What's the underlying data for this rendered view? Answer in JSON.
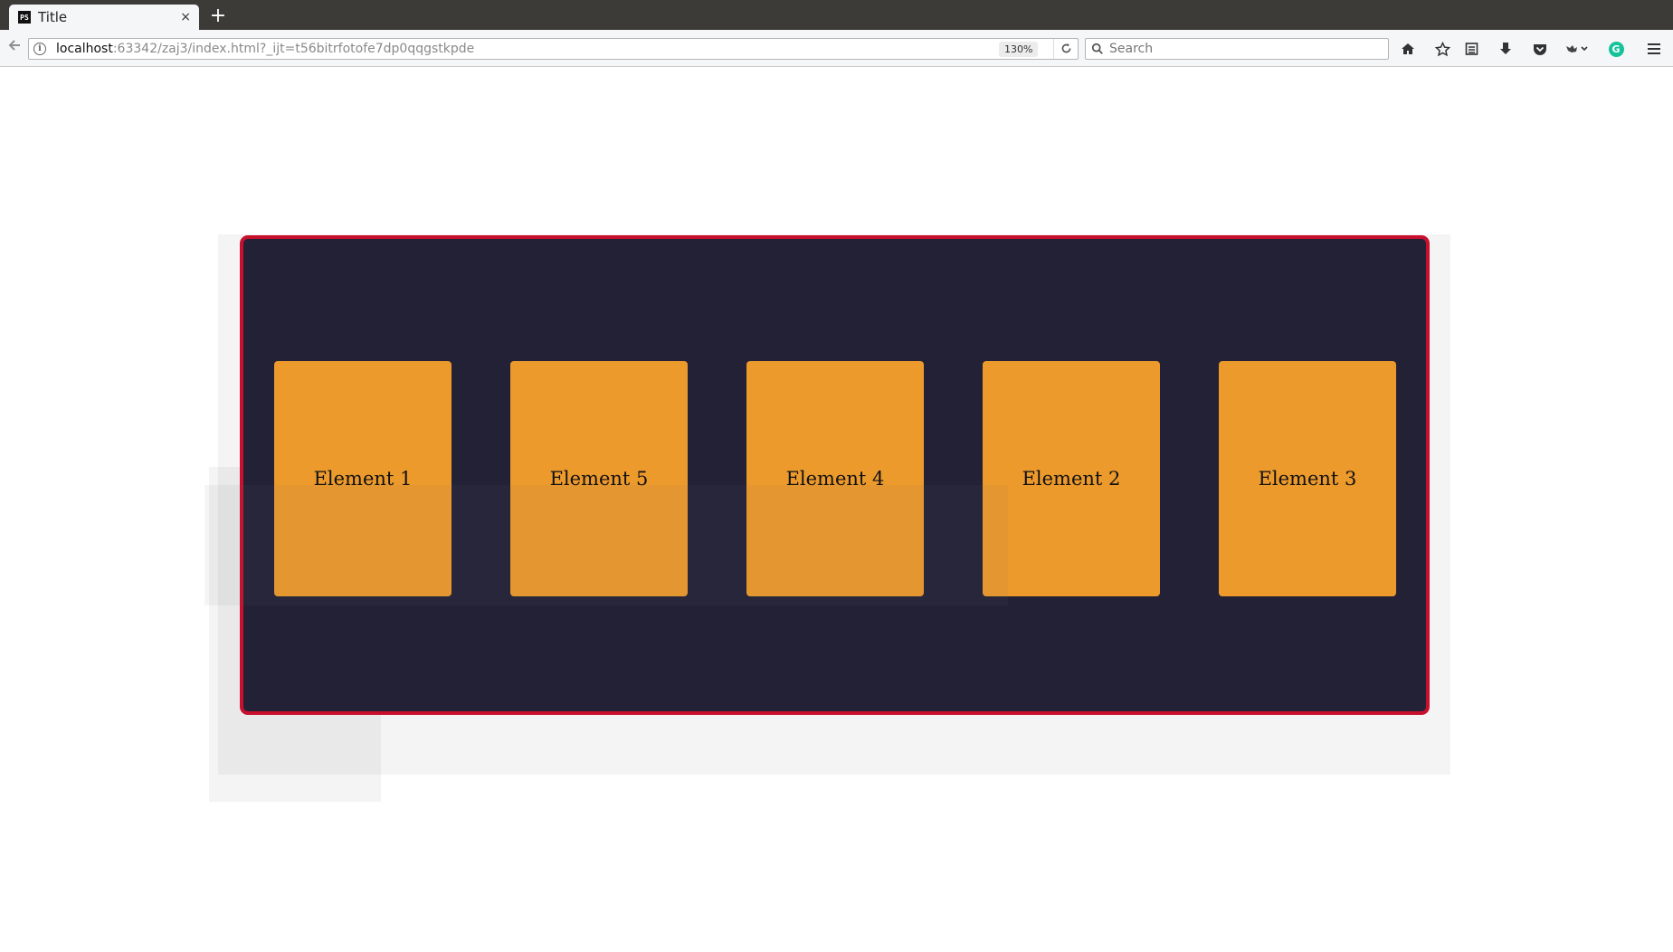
{
  "browser": {
    "tab_title": "Title",
    "tab_favicon": "PS",
    "new_tab_label": "+",
    "close_label": "×",
    "url_host": "localhost",
    "url_rest": ":63342/zaj3/index.html?_ijt=t56bitrfotofe7dp0qqgstkpde",
    "zoom": "130%",
    "search_placeholder": "Search",
    "toolbar_icons": [
      "home-icon",
      "bookmark-star-icon",
      "reader-list-icon",
      "download-icon",
      "pocket-icon",
      "extension-icon",
      "grammarly-icon",
      "menu-icon"
    ],
    "grammarly_letter": "G"
  },
  "page": {
    "elements": [
      {
        "label": "Element 1"
      },
      {
        "label": "Element 5"
      },
      {
        "label": "Element 4"
      },
      {
        "label": "Element 2"
      },
      {
        "label": "Element 3"
      }
    ]
  },
  "colors": {
    "container_background": "#232136",
    "container_border": "#c8102e",
    "card_background": "#ed9a2d"
  }
}
